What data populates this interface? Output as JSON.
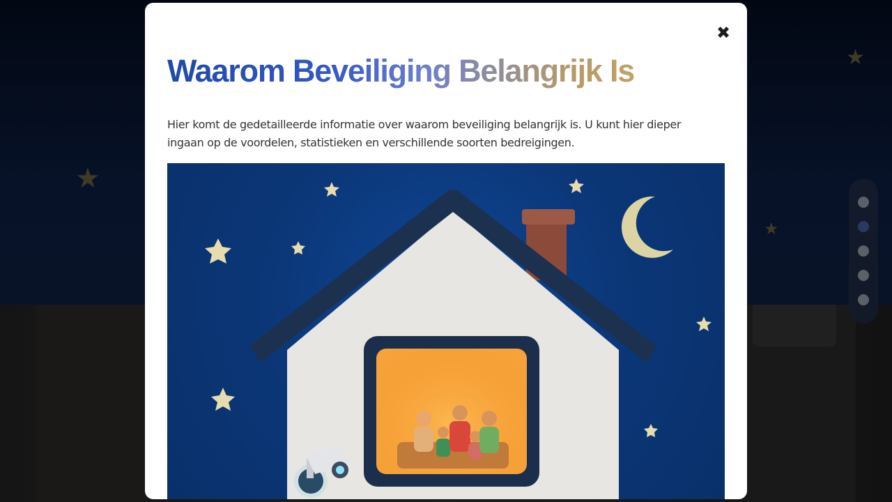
{
  "modal": {
    "close_icon": "close-icon",
    "title": "Waarom Beveiliging Belangrijk Is",
    "text": "Hier komt de gedetailleerde informatie over waarom beveiliging belangrijk is. U kunt hier dieper ingaan op de voordelen, statistieken en verschillende soorten bedreigingen.",
    "close_glyph": "✖"
  },
  "scroll_nav": {
    "count": 5,
    "active_index": 1
  },
  "colors": {
    "title_gradient_start": "#1e4aa6",
    "title_gradient_end": "#c0a266",
    "night_sky": "#0b3676",
    "window_glow": "#f7a33a"
  }
}
